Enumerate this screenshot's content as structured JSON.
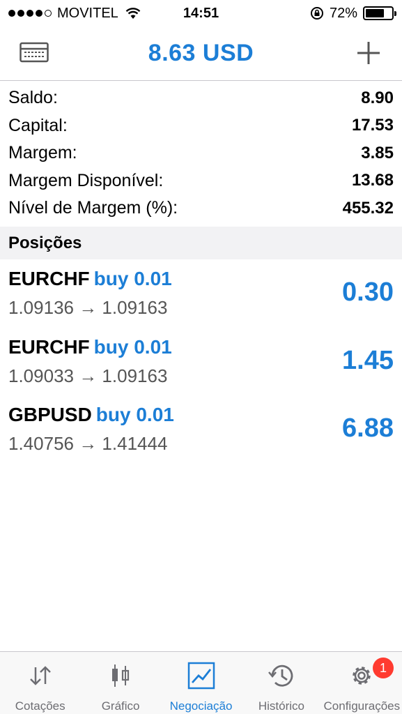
{
  "status_bar": {
    "carrier": "MOVITEL",
    "time": "14:51",
    "battery": "72%",
    "battery_level": 0.72
  },
  "header": {
    "title": "8.63 USD",
    "left_icon": "terminal-card-icon",
    "right_icon": "plus-icon"
  },
  "account": [
    {
      "label": "Saldo:",
      "value": "8.90"
    },
    {
      "label": "Capital:",
      "value": "17.53"
    },
    {
      "label": "Margem:",
      "value": "3.85"
    },
    {
      "label": "Margem Disponível:",
      "value": "13.68"
    },
    {
      "label": "Nível de Margem (%):",
      "value": "455.32"
    }
  ],
  "positions_header": "Posições",
  "positions": [
    {
      "symbol": "EURCHF",
      "action": "buy 0.01",
      "prices": "1.09136 → 1.09163",
      "profit": "0.30"
    },
    {
      "symbol": "EURCHF",
      "action": "buy 0.01",
      "prices": "1.09033 → 1.09163",
      "profit": "1.45"
    },
    {
      "symbol": "GBPUSD",
      "action": "buy 0.01",
      "prices": "1.40756 → 1.41444",
      "profit": "6.88"
    }
  ],
  "tabs": [
    {
      "label": "Cotações",
      "icon": "quotes-arrows-icon"
    },
    {
      "label": "Gráfico",
      "icon": "candlestick-chart-icon"
    },
    {
      "label": "Negociação",
      "icon": "trade-chart-icon",
      "active": true
    },
    {
      "label": "Histórico",
      "icon": "history-clock-icon"
    },
    {
      "label": "Configurações",
      "icon": "gear-icon",
      "badge": "1"
    }
  ],
  "colors": {
    "accent": "#1c7ed6",
    "badge": "#ff3b30",
    "inactive_tab": "#6d6d72"
  }
}
